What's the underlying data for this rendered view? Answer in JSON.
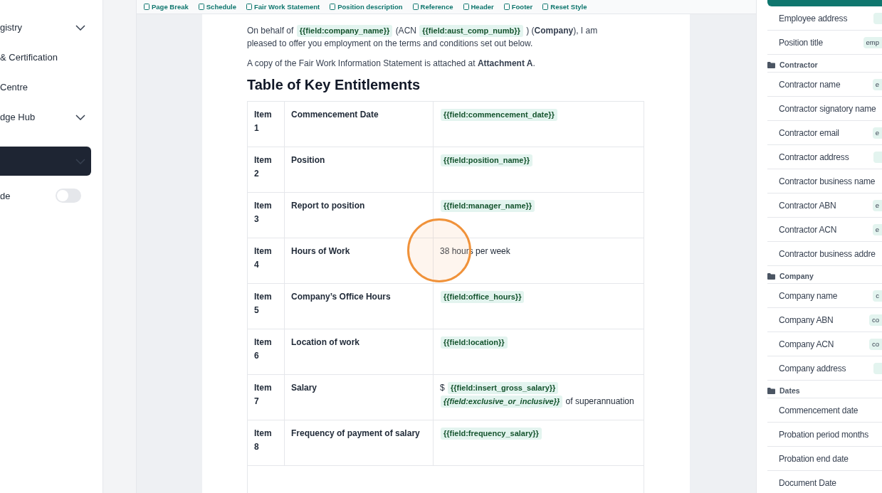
{
  "sidebar": {
    "items": [
      {
        "label": "gistry",
        "expandable": true,
        "selected": false
      },
      {
        "label": "& Certification",
        "expandable": false,
        "selected": false
      },
      {
        "label": "Centre",
        "expandable": false,
        "selected": false
      },
      {
        "label": "dge Hub",
        "expandable": true,
        "selected": false
      },
      {
        "expandable": true,
        "selected": true
      }
    ],
    "toggle": {
      "label": "de",
      "on": false
    }
  },
  "toolbar": {
    "buttons": [
      "Page Break",
      "Schedule",
      "Fair Work Statement",
      "Position description",
      "Reference",
      "Header",
      "Footer",
      "Reset Style"
    ]
  },
  "document": {
    "paragraphs": [
      [
        {
          "kind": "text",
          "text": "On behalf of"
        },
        {
          "kind": "field",
          "text": "{{field:company_name}}"
        },
        {
          "kind": "text",
          "text": "(ACN"
        },
        {
          "kind": "field",
          "text": "{{field:aust_comp_numb}}"
        },
        {
          "kind": "text",
          "text": ") (**Company**), I am"
        },
        {
          "kind": "text",
          "text": "pleased to offer you employment on the terms and conditions set out below."
        }
      ],
      [
        {
          "kind": "text",
          "text": "A copy of the Fair Work Information Statement is attached at **Attachment A**."
        }
      ]
    ],
    "heading": "Table of Key Entitlements",
    "table": {
      "rows": [
        {
          "item": "Item 1",
          "label": "Commencement Date",
          "value": [
            {
              "kind": "field",
              "text": "{{field:commencement_date}}"
            }
          ]
        },
        {
          "item": "Item 2",
          "label": "Position",
          "value": [
            {
              "kind": "field",
              "text": "{{field:position_name}}"
            }
          ]
        },
        {
          "item": "Item 3",
          "label": "Report to position",
          "value": [
            {
              "kind": "field",
              "text": "{{field:manager_name}}"
            }
          ]
        },
        {
          "item": "Item 4",
          "label": "Hours of Work",
          "value": [
            {
              "kind": "text",
              "text": "38 hours per week"
            }
          ]
        },
        {
          "item": "Item 5",
          "label": "Company’s Office Hours",
          "value": [
            {
              "kind": "field",
              "text": "{{field:office_hours}}"
            }
          ]
        },
        {
          "item": "Item 6",
          "label": "Location of work",
          "value": [
            {
              "kind": "field",
              "text": "{{field:location}}"
            }
          ]
        },
        {
          "item": "Item 7",
          "label": "Salary",
          "value": [
            {
              "kind": "text",
              "text": "$"
            },
            {
              "kind": "field",
              "text": "{{field:insert_gross_salary}}"
            },
            {
              "kind": "field_italic",
              "text": "{{field:exclusive_or_inclusive}}"
            },
            {
              "kind": "text",
              "text": "of"
            },
            {
              "kind": "text",
              "text": "superannuation"
            }
          ]
        },
        {
          "item": "Item 8",
          "label": "Frequency of payment of salary",
          "value": [
            {
              "kind": "field",
              "text": "{{field:frequency_salary}}"
            }
          ]
        }
      ]
    }
  },
  "fields_panel": {
    "groups": [
      {
        "fields": [
          {
            "label": "Employee address",
            "chip_visible": true
          },
          {
            "label": "Position title",
            "chip": "emp"
          }
        ]
      },
      {
        "name": "Contractor",
        "fields": [
          {
            "label": "Contractor name",
            "chip": "e"
          },
          {
            "label": "Contractor signatory name"
          },
          {
            "label": "Contractor email",
            "chip": "e"
          },
          {
            "label": "Contractor address",
            "chip_visible": true
          },
          {
            "label": "Contractor business name"
          },
          {
            "label": "Contractor ABN",
            "chip": "e"
          },
          {
            "label": "Contractor ACN",
            "chip": "e"
          },
          {
            "label": "Contractor business addre"
          }
        ]
      },
      {
        "name": "Company",
        "fields": [
          {
            "label": "Company name",
            "chip": "c"
          },
          {
            "label": "Company ABN",
            "chip": "co"
          },
          {
            "label": "Company ACN",
            "chip": "co"
          },
          {
            "label": "Company address",
            "chip_visible": true
          }
        ]
      },
      {
        "name": "Dates",
        "fields": [
          {
            "label": "Commencement date"
          },
          {
            "label": "Probation period months"
          },
          {
            "label": "Probation end date"
          },
          {
            "label": "Document Date"
          }
        ]
      }
    ]
  }
}
